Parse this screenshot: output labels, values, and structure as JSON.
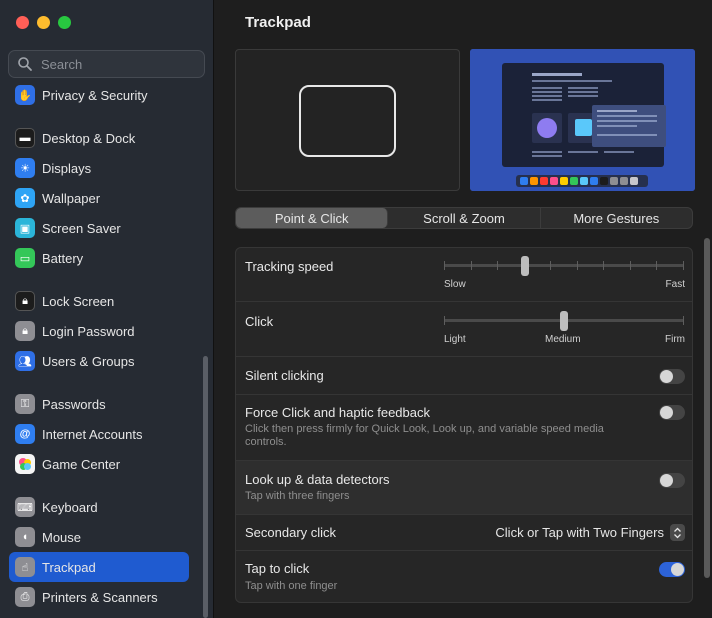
{
  "window": {
    "traffic_lights": [
      "close",
      "minimize",
      "zoom"
    ]
  },
  "search": {
    "placeholder": "Search",
    "value": ""
  },
  "sidebar": {
    "items": [
      {
        "label": "Privacy & Security",
        "icon": "hand-icon",
        "color": "#2f6fe6"
      },
      {
        "label": "Desktop & Dock",
        "icon": "dock-icon",
        "color": "#1c1c1c"
      },
      {
        "label": "Displays",
        "icon": "sun-icon",
        "color": "#2f7ef0"
      },
      {
        "label": "Wallpaper",
        "icon": "flower-icon",
        "color": "#2ea4f5"
      },
      {
        "label": "Screen Saver",
        "icon": "screensaver-icon",
        "color": "#2bb5d9"
      },
      {
        "label": "Battery",
        "icon": "battery-icon",
        "color": "#34c759"
      },
      {
        "label": "Lock Screen",
        "icon": "lock-icon",
        "color": "#1c1c1c"
      },
      {
        "label": "Login Password",
        "icon": "lock-icon",
        "color": "#8e8e93"
      },
      {
        "label": "Users & Groups",
        "icon": "users-icon",
        "color": "#2f6fe6"
      },
      {
        "label": "Passwords",
        "icon": "key-icon",
        "color": "#8e8e93"
      },
      {
        "label": "Internet Accounts",
        "icon": "at-icon",
        "color": "#2f7ef0"
      },
      {
        "label": "Game Center",
        "icon": "game-center-icon",
        "color": "#f5f5f5"
      },
      {
        "label": "Keyboard",
        "icon": "keyboard-icon",
        "color": "#8e8e93"
      },
      {
        "label": "Mouse",
        "icon": "mouse-icon",
        "color": "#8e8e93"
      },
      {
        "label": "Trackpad",
        "icon": "trackpad-icon",
        "color": "#8e8e93"
      },
      {
        "label": "Printers & Scanners",
        "icon": "printer-icon",
        "color": "#8e8e93"
      }
    ],
    "selected": "Trackpad"
  },
  "main": {
    "title": "Trackpad",
    "tabs": [
      {
        "label": "Point & Click",
        "active": true
      },
      {
        "label": "Scroll & Zoom",
        "active": false
      },
      {
        "label": "More Gestures",
        "active": false
      }
    ],
    "rows": {
      "tracking": {
        "label": "Tracking speed",
        "min_label": "Slow",
        "max_label": "Fast",
        "value_fraction": 0.33
      },
      "click": {
        "label": "Click",
        "labels": [
          "Light",
          "Medium",
          "Firm"
        ],
        "value_fraction": 0.5
      },
      "silent": {
        "label": "Silent clicking",
        "on": false
      },
      "force": {
        "label": "Force Click and haptic feedback",
        "sub": "Click then press firmly for Quick Look, Look up, and variable speed media controls.",
        "on": false
      },
      "lookup": {
        "label": "Look up & data detectors",
        "sub": "Tap with three fingers",
        "on": false
      },
      "secondary": {
        "label": "Secondary click",
        "value": "Click or Tap with Two Fingers"
      },
      "tap": {
        "label": "Tap to click",
        "sub": "Tap with one finger",
        "on": true
      }
    }
  },
  "colors": {
    "accent": "#1f5bd0",
    "toggle_on": "#2d63d8"
  }
}
